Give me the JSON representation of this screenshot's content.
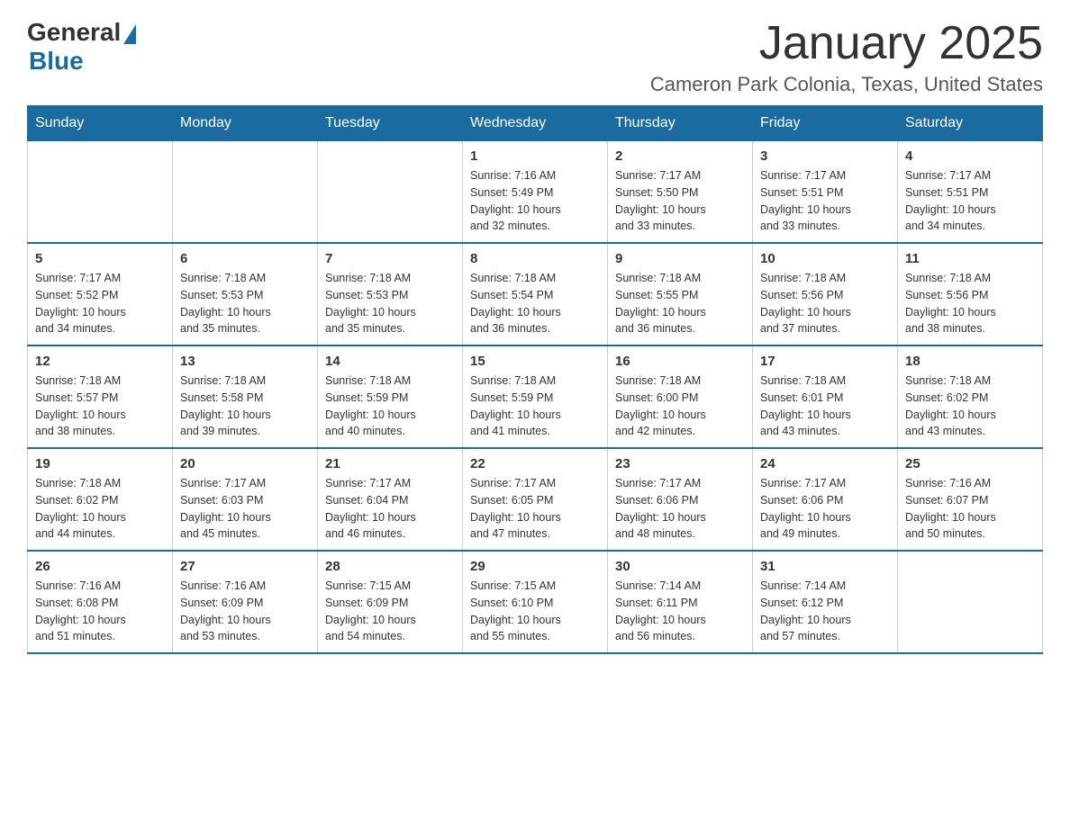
{
  "logo": {
    "general_text": "General",
    "blue_text": "Blue"
  },
  "page": {
    "title": "January 2025",
    "subtitle": "Cameron Park Colonia, Texas, United States"
  },
  "days_of_week": [
    "Sunday",
    "Monday",
    "Tuesday",
    "Wednesday",
    "Thursday",
    "Friday",
    "Saturday"
  ],
  "weeks": [
    [
      {
        "day": "",
        "info": ""
      },
      {
        "day": "",
        "info": ""
      },
      {
        "day": "",
        "info": ""
      },
      {
        "day": "1",
        "info": "Sunrise: 7:16 AM\nSunset: 5:49 PM\nDaylight: 10 hours\nand 32 minutes."
      },
      {
        "day": "2",
        "info": "Sunrise: 7:17 AM\nSunset: 5:50 PM\nDaylight: 10 hours\nand 33 minutes."
      },
      {
        "day": "3",
        "info": "Sunrise: 7:17 AM\nSunset: 5:51 PM\nDaylight: 10 hours\nand 33 minutes."
      },
      {
        "day": "4",
        "info": "Sunrise: 7:17 AM\nSunset: 5:51 PM\nDaylight: 10 hours\nand 34 minutes."
      }
    ],
    [
      {
        "day": "5",
        "info": "Sunrise: 7:17 AM\nSunset: 5:52 PM\nDaylight: 10 hours\nand 34 minutes."
      },
      {
        "day": "6",
        "info": "Sunrise: 7:18 AM\nSunset: 5:53 PM\nDaylight: 10 hours\nand 35 minutes."
      },
      {
        "day": "7",
        "info": "Sunrise: 7:18 AM\nSunset: 5:53 PM\nDaylight: 10 hours\nand 35 minutes."
      },
      {
        "day": "8",
        "info": "Sunrise: 7:18 AM\nSunset: 5:54 PM\nDaylight: 10 hours\nand 36 minutes."
      },
      {
        "day": "9",
        "info": "Sunrise: 7:18 AM\nSunset: 5:55 PM\nDaylight: 10 hours\nand 36 minutes."
      },
      {
        "day": "10",
        "info": "Sunrise: 7:18 AM\nSunset: 5:56 PM\nDaylight: 10 hours\nand 37 minutes."
      },
      {
        "day": "11",
        "info": "Sunrise: 7:18 AM\nSunset: 5:56 PM\nDaylight: 10 hours\nand 38 minutes."
      }
    ],
    [
      {
        "day": "12",
        "info": "Sunrise: 7:18 AM\nSunset: 5:57 PM\nDaylight: 10 hours\nand 38 minutes."
      },
      {
        "day": "13",
        "info": "Sunrise: 7:18 AM\nSunset: 5:58 PM\nDaylight: 10 hours\nand 39 minutes."
      },
      {
        "day": "14",
        "info": "Sunrise: 7:18 AM\nSunset: 5:59 PM\nDaylight: 10 hours\nand 40 minutes."
      },
      {
        "day": "15",
        "info": "Sunrise: 7:18 AM\nSunset: 5:59 PM\nDaylight: 10 hours\nand 41 minutes."
      },
      {
        "day": "16",
        "info": "Sunrise: 7:18 AM\nSunset: 6:00 PM\nDaylight: 10 hours\nand 42 minutes."
      },
      {
        "day": "17",
        "info": "Sunrise: 7:18 AM\nSunset: 6:01 PM\nDaylight: 10 hours\nand 43 minutes."
      },
      {
        "day": "18",
        "info": "Sunrise: 7:18 AM\nSunset: 6:02 PM\nDaylight: 10 hours\nand 43 minutes."
      }
    ],
    [
      {
        "day": "19",
        "info": "Sunrise: 7:18 AM\nSunset: 6:02 PM\nDaylight: 10 hours\nand 44 minutes."
      },
      {
        "day": "20",
        "info": "Sunrise: 7:17 AM\nSunset: 6:03 PM\nDaylight: 10 hours\nand 45 minutes."
      },
      {
        "day": "21",
        "info": "Sunrise: 7:17 AM\nSunset: 6:04 PM\nDaylight: 10 hours\nand 46 minutes."
      },
      {
        "day": "22",
        "info": "Sunrise: 7:17 AM\nSunset: 6:05 PM\nDaylight: 10 hours\nand 47 minutes."
      },
      {
        "day": "23",
        "info": "Sunrise: 7:17 AM\nSunset: 6:06 PM\nDaylight: 10 hours\nand 48 minutes."
      },
      {
        "day": "24",
        "info": "Sunrise: 7:17 AM\nSunset: 6:06 PM\nDaylight: 10 hours\nand 49 minutes."
      },
      {
        "day": "25",
        "info": "Sunrise: 7:16 AM\nSunset: 6:07 PM\nDaylight: 10 hours\nand 50 minutes."
      }
    ],
    [
      {
        "day": "26",
        "info": "Sunrise: 7:16 AM\nSunset: 6:08 PM\nDaylight: 10 hours\nand 51 minutes."
      },
      {
        "day": "27",
        "info": "Sunrise: 7:16 AM\nSunset: 6:09 PM\nDaylight: 10 hours\nand 53 minutes."
      },
      {
        "day": "28",
        "info": "Sunrise: 7:15 AM\nSunset: 6:09 PM\nDaylight: 10 hours\nand 54 minutes."
      },
      {
        "day": "29",
        "info": "Sunrise: 7:15 AM\nSunset: 6:10 PM\nDaylight: 10 hours\nand 55 minutes."
      },
      {
        "day": "30",
        "info": "Sunrise: 7:14 AM\nSunset: 6:11 PM\nDaylight: 10 hours\nand 56 minutes."
      },
      {
        "day": "31",
        "info": "Sunrise: 7:14 AM\nSunset: 6:12 PM\nDaylight: 10 hours\nand 57 minutes."
      },
      {
        "day": "",
        "info": ""
      }
    ]
  ]
}
